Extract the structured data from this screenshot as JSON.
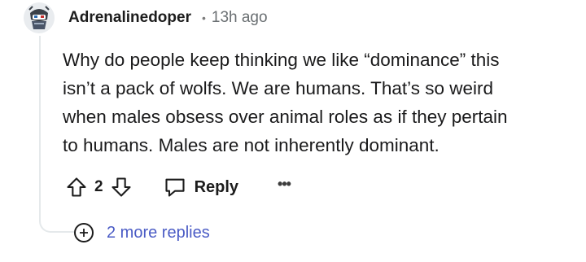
{
  "comment": {
    "author": "Adrenalinedoper",
    "separator": "•",
    "timestamp": "13h ago",
    "avatar_icon": "avatar-icon",
    "body_lines": [
      "Why do people keep thinking we like “dominance” this",
      "isn’t a pack of wolfs. We are humans. That’s so weird",
      "when males obsess over animal roles as if they pertain",
      "to humans. Males are not inherently dominant."
    ],
    "score": "2",
    "reply_label": "Reply",
    "more_options": "•••",
    "more_replies_label": "2 more replies"
  },
  "colors": {
    "link": "#4a5bc5",
    "thread_line": "#e5e9eb",
    "text": "#1a1a1b",
    "meta": "#6a6f72"
  }
}
